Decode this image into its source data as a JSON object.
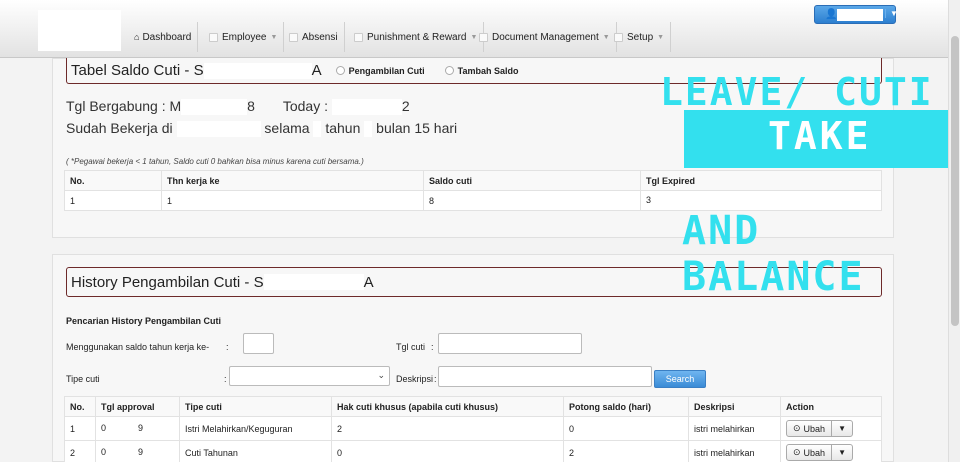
{
  "nav": {
    "items": [
      {
        "label": "Dashboard",
        "icon": "home-icon",
        "caret": false
      },
      {
        "label": "Employee",
        "icon": "user-icon",
        "caret": true
      },
      {
        "label": "Absensi",
        "icon": "calendar-icon",
        "caret": false
      },
      {
        "label": "Punishment & Reward",
        "icon": "award-icon",
        "caret": true
      },
      {
        "label": "Document Management",
        "icon": "folder-icon",
        "caret": true
      },
      {
        "label": "Setup",
        "icon": "gear-icon",
        "caret": true
      }
    ]
  },
  "saldo": {
    "title_prefix": "Tabel Saldo Cuti - S",
    "title_suffix": "A",
    "radio_take": "Pengambilan Cuti",
    "radio_add": "Tambah Saldo",
    "join_label": "Tgl Bergabung : M",
    "join_tail": "8",
    "today_label": "Today :",
    "today_tail": "2",
    "worked_prefix": "Sudah Bekerja di",
    "worked_mid": "selama",
    "worked_tahun": "tahun",
    "worked_tail": "bulan 15 hari",
    "note": "( *Pegawai bekerja < 1 tahun, Saldo cuti 0 bahkan bisa minus karena cuti bersama.)",
    "columns": [
      "No.",
      "Thn kerja ke",
      "Saldo cuti",
      "Tgl Expired"
    ],
    "rows": [
      [
        "1",
        "1",
        "8",
        "3"
      ]
    ]
  },
  "history": {
    "title_prefix": "History Pengambilan Cuti - S",
    "title_suffix": "A",
    "search_title": "Pencarian History Pengambilan Cuti",
    "label_saldo_year": "Menggunakan saldo tahun kerja ke-",
    "label_tgl_cuti": "Tgl cuti",
    "label_tipe": "Tipe cuti",
    "label_deskripsi": "Deskripsi",
    "colon": ":",
    "search_button": "Search",
    "columns": [
      "No.",
      "Tgl approval",
      "Tipe cuti",
      "Hak cuti khusus (apabila cuti khusus)",
      "Potong saldo (hari)",
      "Deskripsi",
      "Action"
    ],
    "rows": [
      {
        "no": "1",
        "tgl_a": "0",
        "tgl_b": "9",
        "tipe": "Istri Melahirkan/Keguguran",
        "hak": "2",
        "potong": "0",
        "desk": "istri melahirkan",
        "action": "Ubah"
      },
      {
        "no": "2",
        "tgl_a": "0",
        "tgl_b": "9",
        "tipe": "Cuti Tahunan",
        "hak": "0",
        "potong": "2",
        "desk": "istri melahirkan",
        "action": "Ubah"
      }
    ]
  },
  "overlay": {
    "line1": "LEAVE/ CUTI",
    "line2": "TAKE",
    "line3": "AND BALANCE",
    "color": "#33e0ee"
  }
}
